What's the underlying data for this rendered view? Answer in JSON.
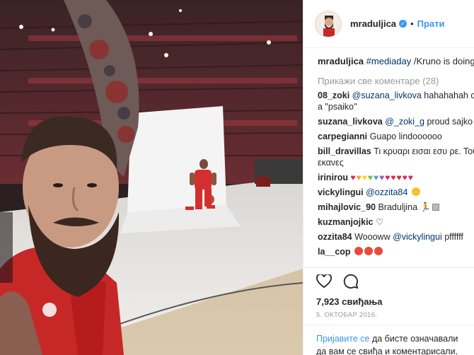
{
  "post": {
    "username": "mraduljica",
    "follow_label": "Прати",
    "separator": "•",
    "caption_user": "mraduljica",
    "caption_hashtag": "#mediaday",
    "caption_text": " /Kruno is doing his magic",
    "load_more": "Прикажи све коментаре (28)",
    "likes": "7,923 свиђања",
    "date": "5. ОКТОБАР 2016.",
    "login_link": "Пријавите се",
    "login_text": " да бисте означавали да вам се свиђа и коментарисали."
  },
  "comments": [
    {
      "user": "08_zoki",
      "mention": "@suzana_livkova",
      "text": " hahahahah du bi so a \"psaiko\""
    },
    {
      "user": "suzana_livkova",
      "mention": "@_zoki_g",
      "text": " proud sajko"
    },
    {
      "user": "carpegianni",
      "text": " Guapo lindoooooo"
    },
    {
      "user": "bill_dravillas",
      "text": " Τι κρυαρι εισαι εσυ ρε. Τουρισμο εκανες"
    },
    {
      "user": "irinirou",
      "text": ""
    },
    {
      "user": "vickylingui",
      "mention": "@ozzita84",
      "text": ""
    },
    {
      "user": "mihajlovic_90",
      "text": " Braduljina"
    },
    {
      "user": "kuzmanjojkic",
      "text": " ♡"
    },
    {
      "user": "ozzita84",
      "text": " Woooww ",
      "mention": "@vickylingui",
      "text2": " pffffff"
    },
    {
      "user": "la__cop",
      "text": ""
    }
  ],
  "icons": {
    "like": "heart-icon",
    "comment": "comment-icon",
    "verified": "verified-badge-icon"
  },
  "colors": {
    "accent": "#3897f0",
    "mention": "#003569",
    "muted": "#999999",
    "jersey": "#c62828"
  }
}
